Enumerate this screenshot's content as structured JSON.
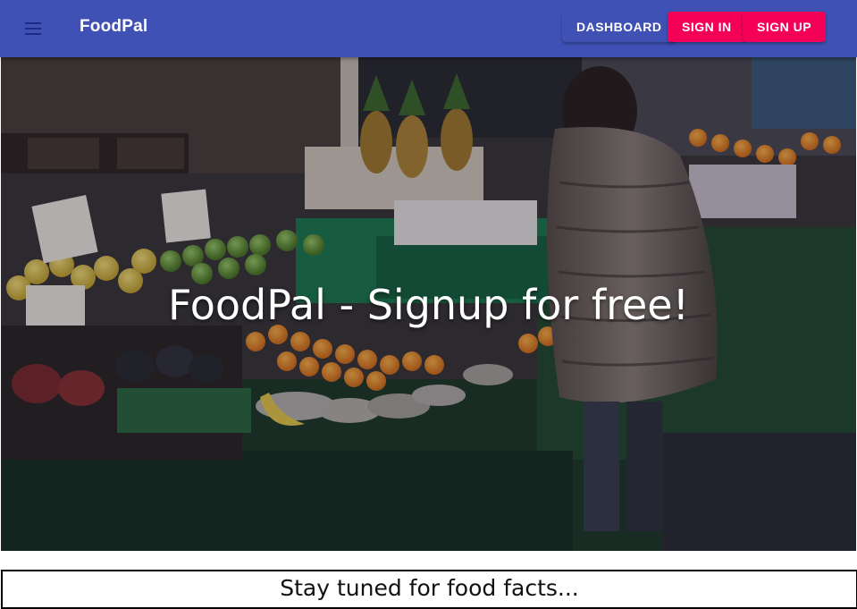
{
  "colors": {
    "appbar": "#3f51b5",
    "secondary": "#f50057",
    "text_on_primary": "#ffffff"
  },
  "appbar": {
    "menu_icon": "hamburger-menu-icon",
    "title": "FoodPal",
    "buttons": {
      "dashboard": "DASHBOARD",
      "signin": "SIGN IN",
      "signup": "SIGN UP"
    }
  },
  "hero": {
    "image": "farmers-market-produce-stall-photo",
    "title": "FoodPal - Signup for free!"
  },
  "facts": {
    "text": "Stay tuned for food facts..."
  }
}
